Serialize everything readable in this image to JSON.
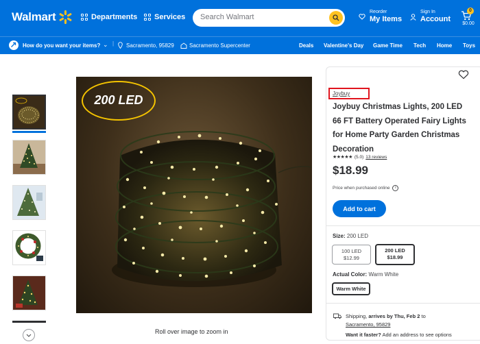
{
  "header": {
    "logo_text": "Walmart",
    "departments": "Departments",
    "services": "Services",
    "search_placeholder": "Search Walmart",
    "reorder_small": "Reorder",
    "reorder_big": "My Items",
    "signin_small": "Sign In",
    "signin_big": "Account",
    "cart_count": "0",
    "cart_total": "$0.00",
    "brand_color": "#0071dc",
    "accent_color": "#ffc220"
  },
  "subbar": {
    "delivery_prompt": "How do you want your items?",
    "location": "Sacramento, 95829",
    "store": "Sacramento Supercenter",
    "links": [
      "Deals",
      "Valentine's Day",
      "Game Time",
      "Tech",
      "Home",
      "Toys"
    ]
  },
  "gallery": {
    "badge_text": "200 LED",
    "zoom_hint": "Roll over image to zoom in"
  },
  "product": {
    "brand": "Joybuy",
    "title": "Joybuy Christmas Lights, 200 LED 66 FT Battery Operated Fairy Lights for Home Party Garden Christmas Decoration",
    "stars": "★★★★★",
    "rating": "(5.0)",
    "reviews": "13 reviews",
    "price": "$18.99",
    "price_note": "Price when purchased online",
    "add_to_cart": "Add to cart",
    "size_label": "Size:",
    "size_value": "200 LED",
    "size_options": [
      {
        "name": "100 LED",
        "price": "$12.99",
        "selected": false
      },
      {
        "name": "200 LED",
        "price": "$18.99",
        "selected": true
      }
    ],
    "color_label": "Actual Color:",
    "color_value": "Warm White",
    "color_option": "Warm White",
    "shipping_prefix": "Shipping,",
    "shipping_arrives": "arrives by Thu, Feb 2",
    "shipping_to": "to",
    "shipping_location": "Sacramento, 95829",
    "faster_bold": "Want it faster?",
    "faster_rest": "Add an address to see options"
  }
}
